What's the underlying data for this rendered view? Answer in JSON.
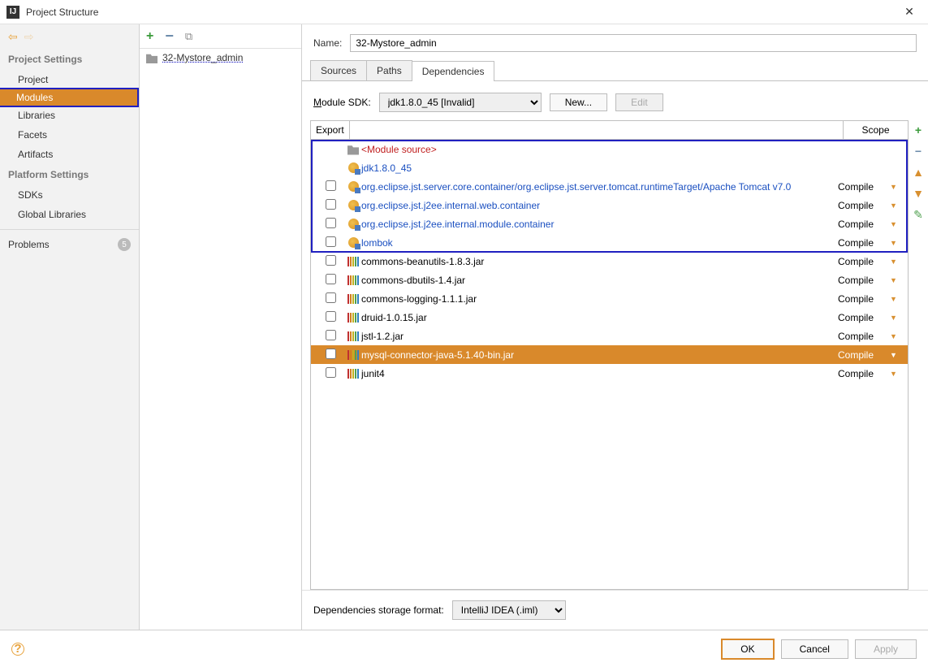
{
  "window": {
    "title": "Project Structure"
  },
  "sidebar": {
    "sections": {
      "project_settings": "Project Settings",
      "platform_settings": "Platform Settings"
    },
    "items": {
      "project": "Project",
      "modules": "Modules",
      "libraries": "Libraries",
      "facets": "Facets",
      "artifacts": "Artifacts",
      "sdks": "SDKs",
      "global_libraries": "Global Libraries",
      "problems": "Problems"
    },
    "problems_count": "5"
  },
  "module_list": {
    "items": [
      "32-Mystore_admin"
    ]
  },
  "detail": {
    "name_label": "Name:",
    "name_value": "32-Mystore_admin",
    "tabs": {
      "sources": "Sources",
      "paths": "Paths",
      "dependencies": "Dependencies"
    },
    "sdk_label": "Module SDK:",
    "sdk_value": "jdk1.8.0_45 [Invalid]",
    "new_btn": "New...",
    "edit_btn": "Edit",
    "table": {
      "header_export": "Export",
      "header_scope": "Scope"
    },
    "rows": [
      {
        "type": "source",
        "label": "<Module source>",
        "checkbox": false,
        "scope": "",
        "linkish": false,
        "red": true
      },
      {
        "type": "jdk",
        "label": "jdk1.8.0_45",
        "checkbox": false,
        "scope": "",
        "linkish": true,
        "red": false
      },
      {
        "type": "globe",
        "label": "org.eclipse.jst.server.core.container/org.eclipse.jst.server.tomcat.runtimeTarget/Apache Tomcat v7.0",
        "checkbox": true,
        "scope": "Compile",
        "linkish": true,
        "red": false
      },
      {
        "type": "globe",
        "label": "org.eclipse.jst.j2ee.internal.web.container",
        "checkbox": true,
        "scope": "Compile",
        "linkish": true,
        "red": false
      },
      {
        "type": "globe",
        "label": "org.eclipse.jst.j2ee.internal.module.container",
        "checkbox": true,
        "scope": "Compile",
        "linkish": true,
        "red": false
      },
      {
        "type": "globe",
        "label": "lombok",
        "checkbox": true,
        "scope": "Compile",
        "linkish": true,
        "red": false
      },
      {
        "type": "lib",
        "label": "commons-beanutils-1.8.3.jar",
        "checkbox": true,
        "scope": "Compile",
        "linkish": false,
        "red": false
      },
      {
        "type": "lib",
        "label": "commons-dbutils-1.4.jar",
        "checkbox": true,
        "scope": "Compile",
        "linkish": false,
        "red": false
      },
      {
        "type": "lib",
        "label": "commons-logging-1.1.1.jar",
        "checkbox": true,
        "scope": "Compile",
        "linkish": false,
        "red": false
      },
      {
        "type": "lib",
        "label": "druid-1.0.15.jar",
        "checkbox": true,
        "scope": "Compile",
        "linkish": false,
        "red": false
      },
      {
        "type": "lib",
        "label": "jstl-1.2.jar",
        "checkbox": true,
        "scope": "Compile",
        "linkish": false,
        "red": false
      },
      {
        "type": "lib",
        "label": "mysql-connector-java-5.1.40-bin.jar",
        "checkbox": true,
        "scope": "Compile",
        "linkish": false,
        "red": false,
        "selected": true
      },
      {
        "type": "lib",
        "label": "junit4",
        "checkbox": true,
        "scope": "Compile",
        "linkish": false,
        "red": false
      }
    ],
    "storage_label": "Dependencies storage format:",
    "storage_value": "IntelliJ IDEA (.iml)"
  },
  "footer": {
    "ok": "OK",
    "cancel": "Cancel",
    "apply": "Apply"
  },
  "colors": {
    "lib_bars": [
      "#c03030",
      "#d08020",
      "#c0b020",
      "#50a050",
      "#3080c0"
    ]
  }
}
